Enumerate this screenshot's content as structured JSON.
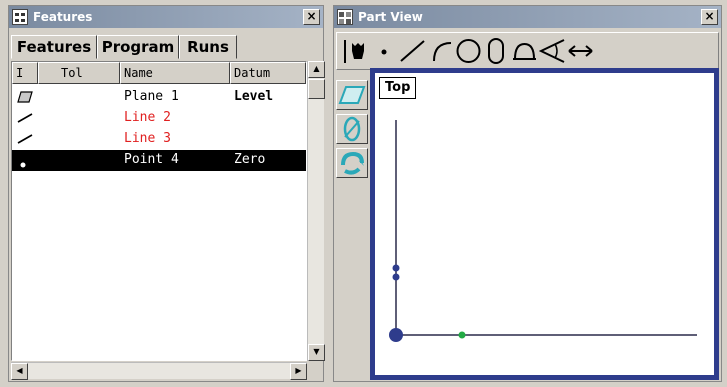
{
  "features_window": {
    "title": "Features",
    "close": "×",
    "tabs": [
      {
        "label": "Features"
      },
      {
        "label": "Program"
      },
      {
        "label": "Runs"
      }
    ],
    "columns": [
      "I",
      "Tol",
      "Name",
      "Datum"
    ],
    "rows": [
      {
        "icon": "plane-icon",
        "name": "Plane 1",
        "datum": "Level",
        "color": "#000000"
      },
      {
        "icon": "line-icon",
        "name": "Line 2",
        "datum": "",
        "color": "#e02020"
      },
      {
        "icon": "line-icon",
        "name": "Line 3",
        "datum": "",
        "color": "#e02020"
      },
      {
        "icon": "point-icon",
        "name": "Point 4",
        "datum": "Zero",
        "color": "#ffffff",
        "selected": true
      }
    ]
  },
  "partview_window": {
    "title": "Part View",
    "close": "×",
    "toolbar": [
      "probe-icon",
      "point-icon",
      "line-icon",
      "arc-icon",
      "circle-icon",
      "slot-icon",
      "arc-segment-icon",
      "angle-icon",
      "distance-icon"
    ],
    "sidebar": [
      "plane-view-icon",
      "circle-view-icon",
      "rotate-view-icon"
    ],
    "view_label": "Top",
    "colors": {
      "frame": "#2e3c8c",
      "points": "#2e3c8c",
      "origin_marker": "#22aa44"
    }
  }
}
